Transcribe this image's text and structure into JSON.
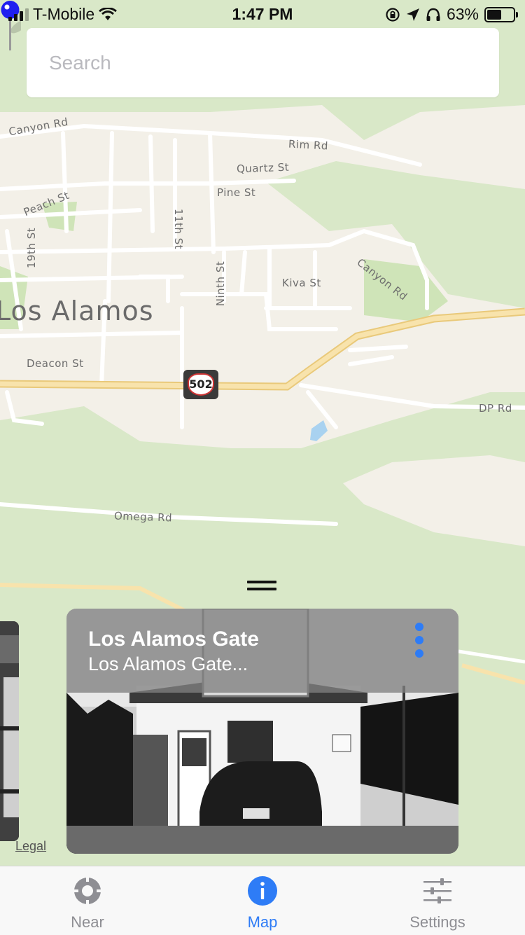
{
  "status_bar": {
    "carrier": "T-Mobile",
    "time": "1:47 PM",
    "battery_percent": "63%",
    "battery_level": 0.63,
    "icons": [
      "signal-icon",
      "wifi-icon",
      "orientation-lock-icon",
      "location-arrow-icon",
      "headphones-icon",
      "battery-icon"
    ]
  },
  "search": {
    "placeholder": "Search",
    "value": ""
  },
  "map": {
    "city_label": "Los Alamos",
    "route_shield": "502",
    "streets": {
      "canyon_rd_top": "Canyon Rd",
      "rim_rd": "Rim Rd",
      "quartz_st": "Quartz St",
      "pine_st": "Pine St",
      "peach_st": "Peach St",
      "eleventh_st": "11th St",
      "nineteenth_st": "19th St",
      "ninth_st": "Ninth St",
      "kiva_st": "Kiva St",
      "canyon_rd_right": "Canyon Rd",
      "deacon_st": "Deacon St",
      "dp_rd": "DP Rd",
      "omega_rd": "Omega Rd"
    },
    "pin_color": "#1f1ff0",
    "legal": "Legal"
  },
  "card": {
    "title": "Los Alamos Gate",
    "subtitle": "Los Alamos Gate...",
    "menu_icon": "more-vertical-icon"
  },
  "tab_bar": {
    "tabs": [
      {
        "label": "Near",
        "icon": "crosshair-icon",
        "active": false
      },
      {
        "label": "Map",
        "icon": "info-icon",
        "active": true
      },
      {
        "label": "Settings",
        "icon": "sliders-icon",
        "active": false
      }
    ]
  },
  "colors": {
    "accent": "#2e7cf6",
    "inactive": "#8e8e93",
    "map_green": "#d9e8c8",
    "road_yellow": "#f6dca0"
  }
}
